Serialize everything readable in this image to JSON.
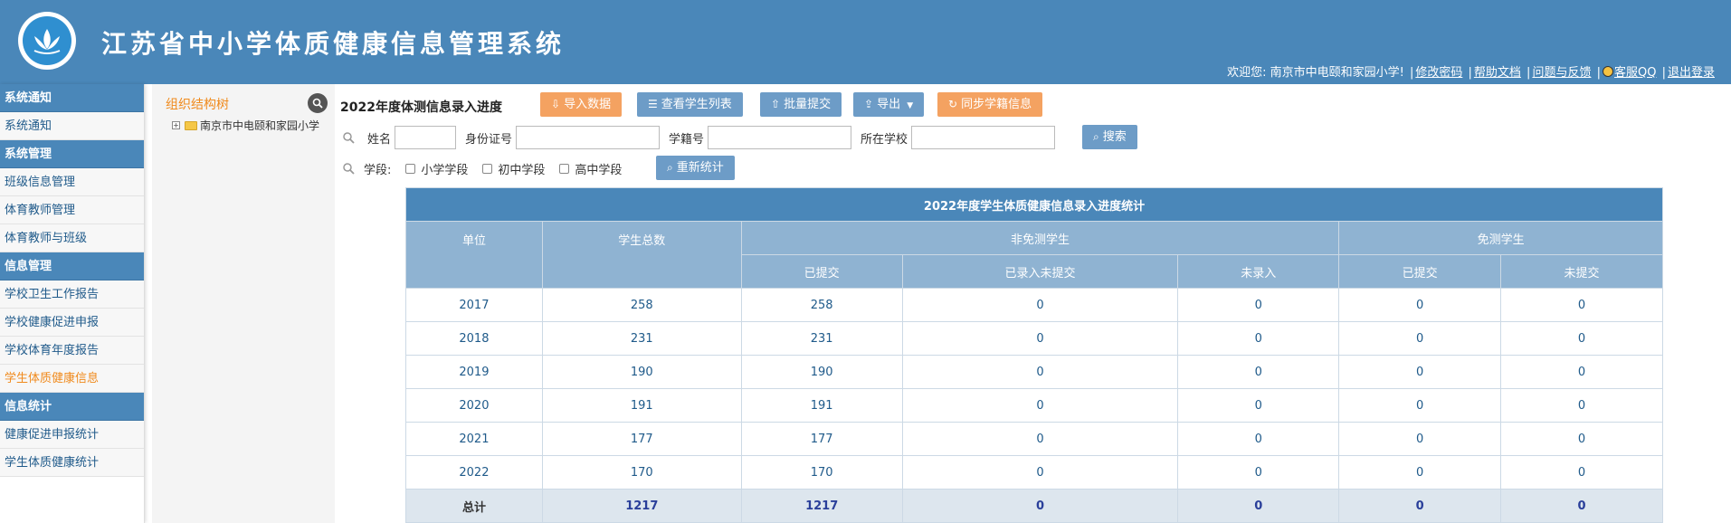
{
  "header": {
    "title": "江苏省中小学体质健康信息管理系统",
    "welcome": "欢迎您: 南京市中电颐和家园小学!",
    "links": [
      "修改密码",
      "帮助文档",
      "问题与反馈",
      "客服QQ",
      "退出登录"
    ]
  },
  "sidebar": {
    "sections": [
      {
        "title": "系统通知",
        "items": [
          "系统通知"
        ]
      },
      {
        "title": "系统管理",
        "items": [
          "班级信息管理",
          "体育教师管理",
          "体育教师与班级"
        ]
      },
      {
        "title": "信息管理",
        "items": [
          "学校卫生工作报告",
          "学校健康促进申报",
          "学校体育年度报告",
          "学生体质健康信息"
        ]
      },
      {
        "title": "信息统计",
        "items": [
          "健康促进申报统计",
          "学生体质健康统计"
        ]
      }
    ],
    "active_item": "学生体质健康信息"
  },
  "tree": {
    "title": "组织结构树",
    "root_node": "南京市中电颐和家园小学"
  },
  "main": {
    "title": "2022年度体测信息录入进度",
    "buttons": {
      "import": "导入数据",
      "view_list": "查看学生列表",
      "batch_submit": "批量提交",
      "export": "导出",
      "sync": "同步学籍信息",
      "search": "搜索",
      "recount": "重新统计"
    },
    "filters": {
      "name_label": "姓名",
      "id_label": "身份证号",
      "student_no_label": "学籍号",
      "school_label": "所在学校",
      "stage_label": "学段:",
      "stages": [
        "小学学段",
        "初中学段",
        "高中学段"
      ]
    }
  },
  "table": {
    "caption": "2022年度学生体质健康信息录入进度统计",
    "headers": {
      "unit": "单位",
      "total": "学生总数",
      "non_exempt": "非免测学生",
      "exempt": "免测学生",
      "submitted": "已提交",
      "entered_not_submitted": "已录入未提交",
      "not_entered": "未录入",
      "exempt_submitted": "已提交",
      "exempt_not_submitted": "未提交"
    },
    "rows": [
      [
        "2017",
        "258",
        "258",
        "0",
        "0",
        "0",
        "0"
      ],
      [
        "2018",
        "231",
        "231",
        "0",
        "0",
        "0",
        "0"
      ],
      [
        "2019",
        "190",
        "190",
        "0",
        "0",
        "0",
        "0"
      ],
      [
        "2020",
        "191",
        "191",
        "0",
        "0",
        "0",
        "0"
      ],
      [
        "2021",
        "177",
        "177",
        "0",
        "0",
        "0",
        "0"
      ],
      [
        "2022",
        "170",
        "170",
        "0",
        "0",
        "0",
        "0"
      ]
    ],
    "total_row": [
      "总计",
      "1217",
      "1217",
      "0",
      "0",
      "0",
      "0"
    ]
  },
  "colors": {
    "header_bg": "#4a87b9",
    "table_subheader": "#8fb3d2",
    "orange_button": "#f4a261",
    "blue_button": "#6d9cc7",
    "active_link": "#f08a1c"
  }
}
